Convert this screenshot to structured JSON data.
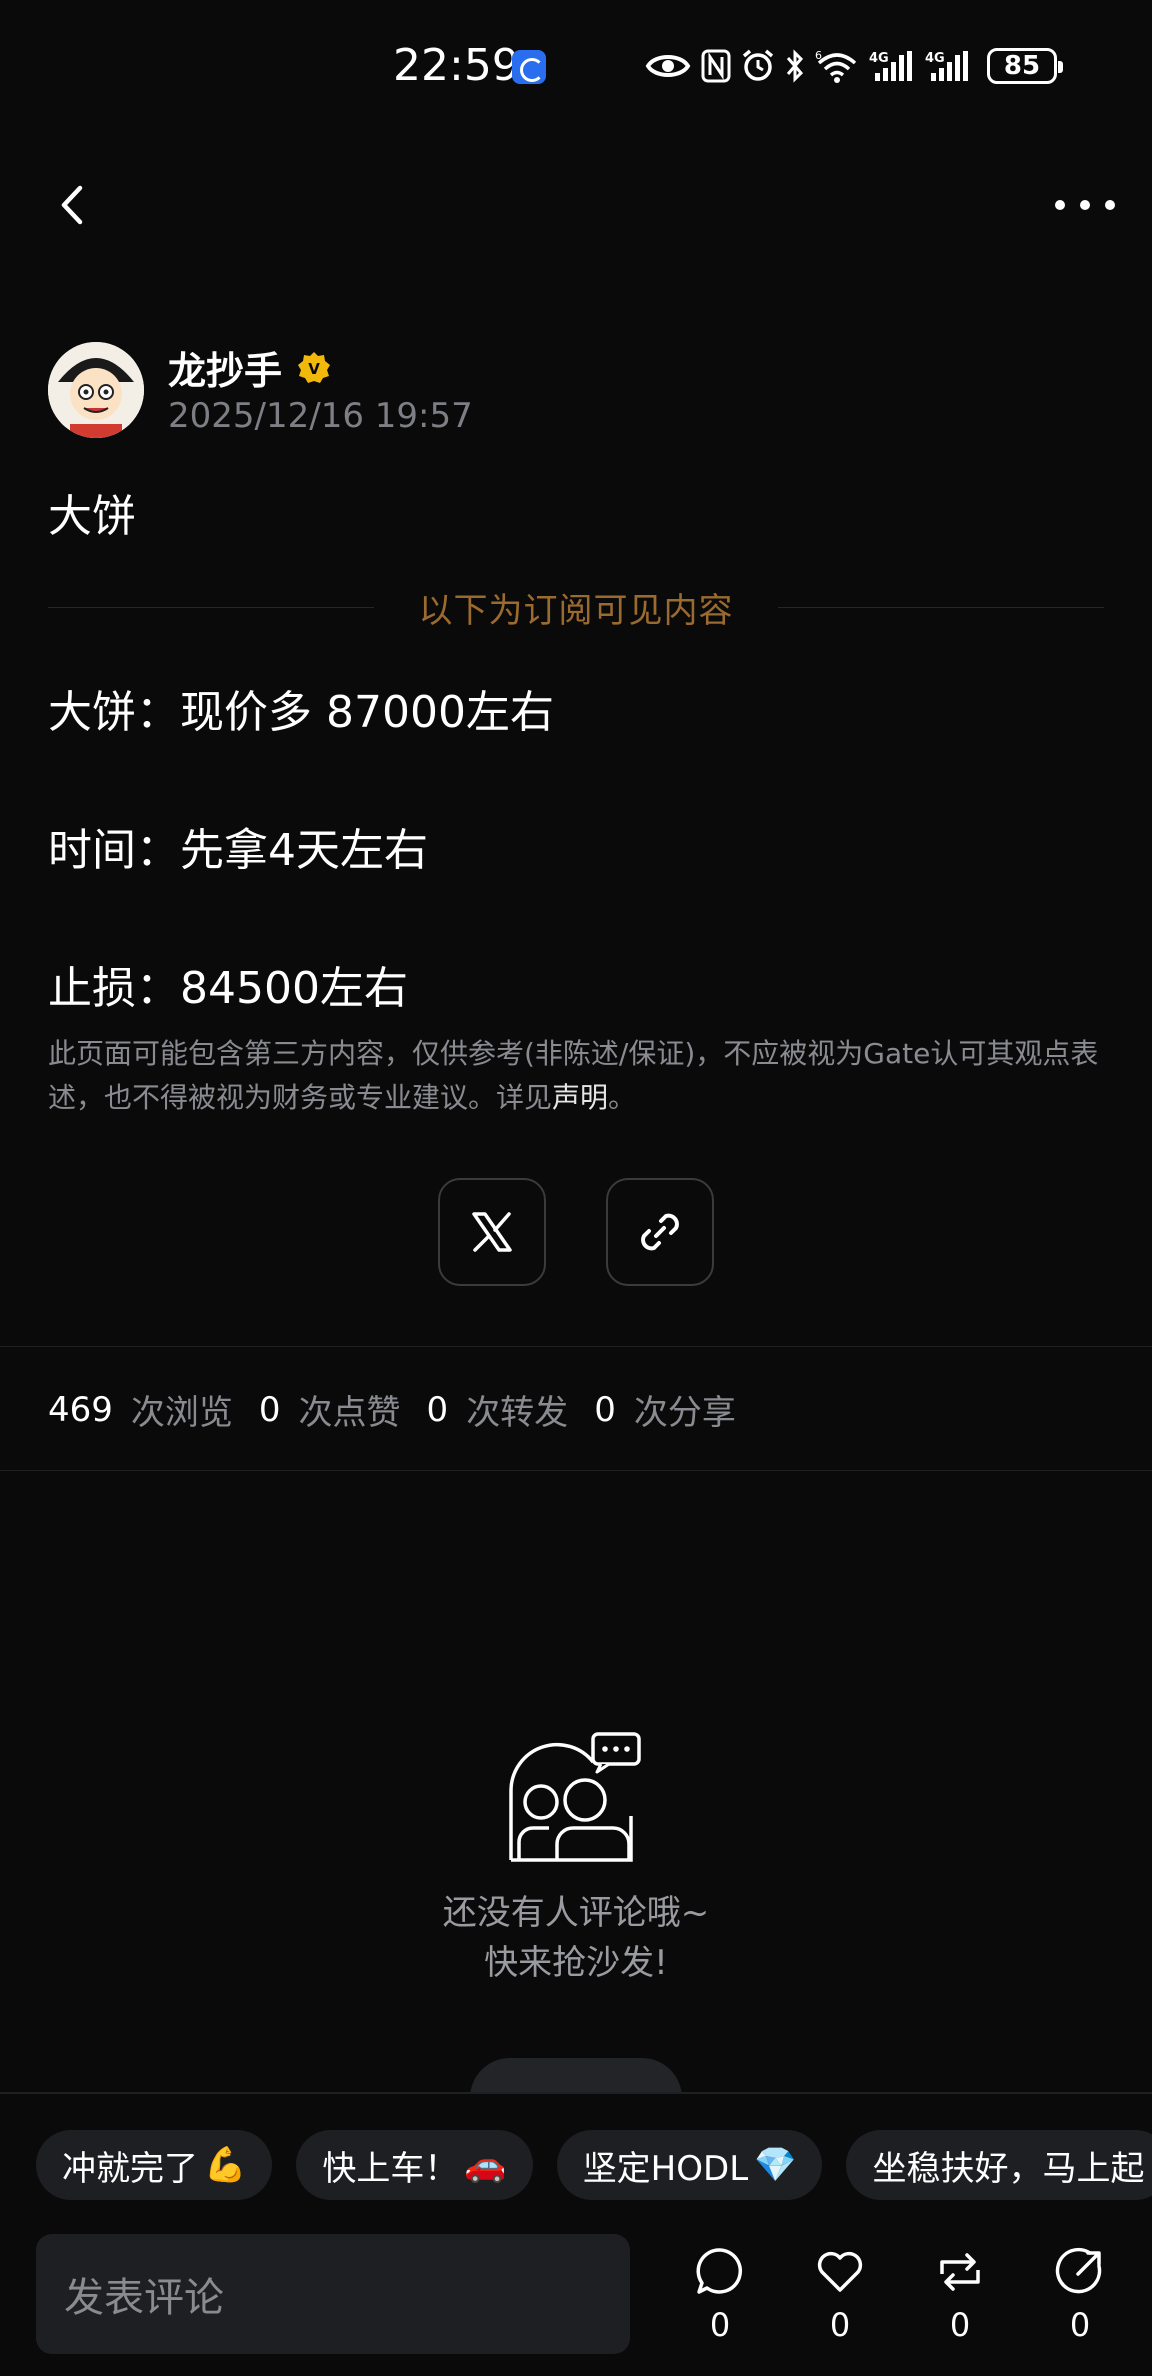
{
  "status_bar": {
    "time": "22:59",
    "battery": "85",
    "network_1": "4G",
    "network_2": "4G",
    "wifi_label": "6"
  },
  "nav": {
    "back_icon": "chevron-left-icon",
    "more_icon": "more-horizontal-icon"
  },
  "author": {
    "name": "龙抄手",
    "badge": "V",
    "time": "2025/12/16 19:57"
  },
  "post": {
    "title": "大饼",
    "subscription_divider": "以下为订阅可见内容",
    "lines": [
      "大饼：现价多 87000左右",
      "时间：先拿4天左右",
      "止损：84500左右"
    ],
    "disclaimer_text": "此页面可能包含第三方内容，仅供参考(非陈述/保证)，不应被视为Gate认可其观点表述，也不得被视为财务或专业建议。详见",
    "disclaimer_link": "声明",
    "disclaimer_end": "。"
  },
  "share": {
    "x_icon": "x-logo-icon",
    "link_icon": "link-icon"
  },
  "stats": {
    "views": "469",
    "views_label": "次浏览",
    "likes": "0",
    "likes_label": "次点赞",
    "reposts": "0",
    "reposts_label": "次转发",
    "shares": "0",
    "shares_label": "次分享"
  },
  "empty_state": {
    "line1": "还没有人评论哦~",
    "line2": "快来抢沙发!"
  },
  "quick_replies": [
    {
      "text": "冲就完了",
      "emoji": "💪"
    },
    {
      "text": "快上车！",
      "emoji": "🚗"
    },
    {
      "text": "坚定HODL",
      "emoji": "💎"
    },
    {
      "text": "坐稳扶好，马上起",
      "emoji": ""
    }
  ],
  "comment_box": {
    "placeholder": "发表评论"
  },
  "actions": {
    "comment_count": "0",
    "like_count": "0",
    "repost_count": "0",
    "share_count": "0"
  },
  "colors": {
    "background": "#0a0a0b",
    "accent_gold": "#9a6a2e",
    "badge_gold": "#f0b90b",
    "muted_text": "#8a8b90"
  }
}
